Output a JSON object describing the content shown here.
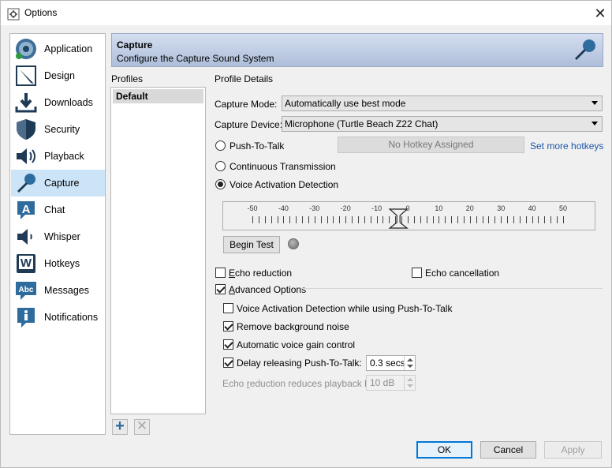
{
  "window": {
    "title": "Options",
    "close_glyph": "✕"
  },
  "sidebar": {
    "items": [
      {
        "label": "Application",
        "icon": "teamtalk-logo-icon"
      },
      {
        "label": "Design",
        "icon": "pencil-icon"
      },
      {
        "label": "Downloads",
        "icon": "download-icon"
      },
      {
        "label": "Security",
        "icon": "shield-icon"
      },
      {
        "label": "Playback",
        "icon": "speaker-icon"
      },
      {
        "label": "Capture",
        "icon": "microphone-icon",
        "active": true
      },
      {
        "label": "Chat",
        "icon": "chat-icon"
      },
      {
        "label": "Whisper",
        "icon": "whisper-icon"
      },
      {
        "label": "Hotkeys",
        "icon": "hotkey-icon"
      },
      {
        "label": "Messages",
        "icon": "messages-icon"
      },
      {
        "label": "Notifications",
        "icon": "info-icon"
      }
    ]
  },
  "header": {
    "title": "Capture",
    "subtitle": "Configure the Capture Sound System",
    "icon": "microphone-icon"
  },
  "profiles": {
    "label": "Profiles",
    "items": [
      "Default"
    ],
    "add_glyph": "+",
    "remove_glyph": "✕"
  },
  "details": {
    "label": "Profile Details",
    "capture_mode": {
      "label": "Capture Mode:",
      "value": "Automatically use best mode"
    },
    "capture_device": {
      "label": "Capture Device:",
      "value": "Microphone (Turtle Beach Z22 Chat)"
    },
    "push_to_talk": {
      "label": "Push-To-Talk",
      "selected": false
    },
    "hotkey_value": "No Hotkey Assigned",
    "set_hotkeys_link": "Set more hotkeys",
    "continuous": {
      "label": "Continuous Transmission",
      "selected": false
    },
    "voice_activation": {
      "label": "Voice Activation Detection",
      "selected": true
    },
    "slider": {
      "ticks": [
        "-50",
        "-40",
        "-30",
        "-20",
        "-10",
        "0",
        "10",
        "20",
        "30",
        "40",
        "50"
      ],
      "value": -3
    },
    "begin_test_label": "Begin Test",
    "echo_reduction": {
      "label_prefix": "",
      "label_u": "E",
      "label_rest": "cho reduction",
      "checked": false
    },
    "echo_cancellation": {
      "label": "Echo cancellation",
      "checked": false
    },
    "advanced": {
      "label_u": "A",
      "label_rest": "dvanced Options",
      "checked": true
    },
    "vad_with_ptt": {
      "label": "Voice Activation Detection while using Push-To-Talk",
      "checked": false
    },
    "remove_noise": {
      "label": "Remove background noise",
      "checked": true
    },
    "agc": {
      "label": "Automatic voice gain control",
      "checked": true
    },
    "delay_release": {
      "label": "Delay releasing Push-To-Talk:",
      "checked": true,
      "value": "0.3 secs"
    },
    "echo_playback": {
      "label_pre": "Echo ",
      "label_u": "r",
      "label_rest": "eduction reduces playback by:",
      "value": "10 dB"
    }
  },
  "buttons": {
    "ok": "OK",
    "cancel": "Cancel",
    "apply": "Apply"
  }
}
